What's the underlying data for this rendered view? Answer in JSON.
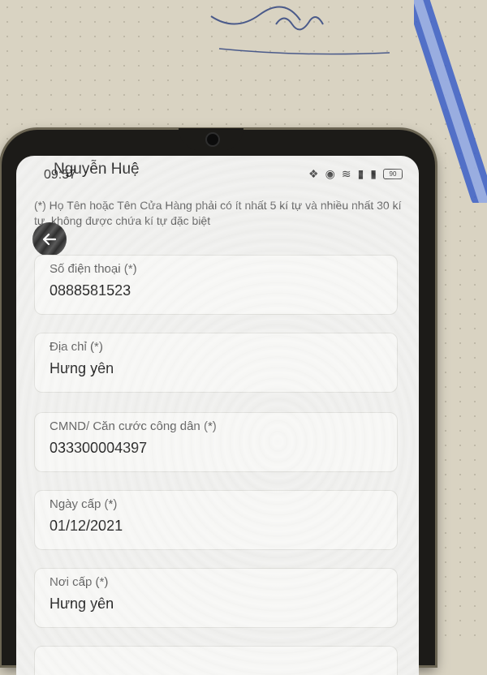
{
  "status_bar": {
    "time": "09:57",
    "battery": "90"
  },
  "header": {
    "title": "Nguyễn Huệ"
  },
  "note": "(*) Họ Tên hoặc Tên Cửa Hàng phải có ít nhất 5 kí tự và nhiều nhất 30 kí tự, không được chứa kí tự đặc biệt",
  "fields": [
    {
      "label": "Số điện thoại (*)",
      "value": "0888581523"
    },
    {
      "label": "Địa chỉ (*)",
      "value": "Hưng yên"
    },
    {
      "label": "CMND/ Căn cước công dân (*)",
      "value": "033300004397"
    },
    {
      "label": "Ngày cấp (*)",
      "value": "01/12/2021"
    },
    {
      "label": "Nơi cấp (*)",
      "value": "Hưng yên"
    }
  ],
  "icons": {
    "back": "back-arrow-icon",
    "signal": "signal-icon",
    "wifi": "wifi-icon",
    "location": "location-icon",
    "vibrate": "vibrate-icon"
  },
  "colors": {
    "screen_bg": "#eeeeec",
    "field_bg": "#f6f6f4",
    "back_button": "#2b2b2b"
  }
}
